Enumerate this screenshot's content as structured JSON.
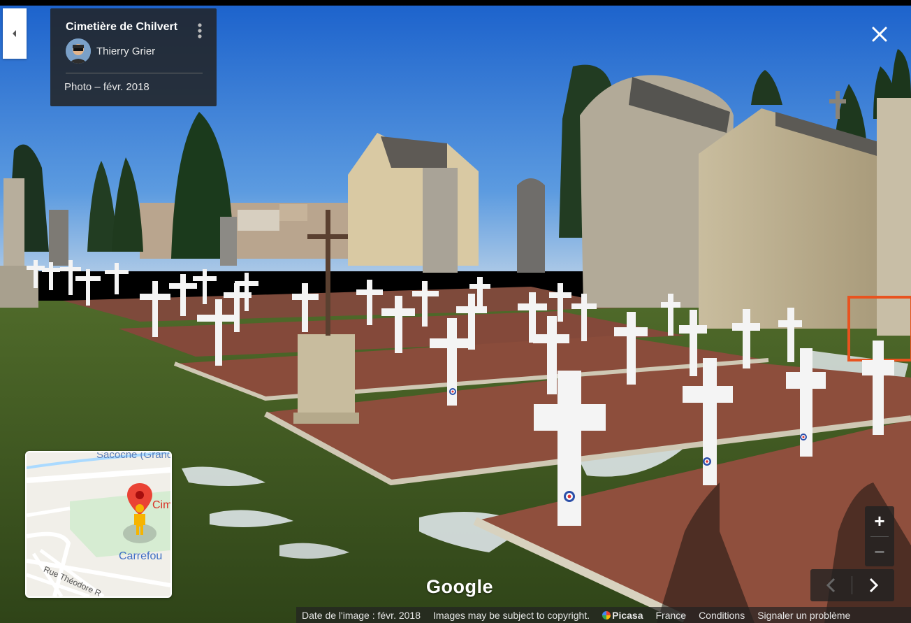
{
  "place": {
    "title": "Cimetière de Chilvert",
    "author": "Thierry Grier",
    "photo_date": "Photo – févr. 2018"
  },
  "minimap": {
    "label_top": "Sacoche (Grand",
    "label_place": "Cim",
    "label_store": "Carrefou",
    "label_street": "Rue Théodore R"
  },
  "branding": {
    "logo": "Google"
  },
  "zoom": {
    "in_label": "+",
    "out_label": "−"
  },
  "footer": {
    "image_date": "Date de l'image : févr. 2018",
    "copyright": "Images may be subject to copyright.",
    "picasa": "Picasa",
    "country": "France",
    "terms": "Conditions",
    "report": "Signaler un problème"
  },
  "icons": {
    "back": "chevron-left-icon",
    "more": "more-vert-icon",
    "close": "close-icon",
    "pin": "map-pin-icon",
    "pegman": "pegman-icon",
    "prev": "chevron-left-icon",
    "next": "chevron-right-icon"
  },
  "colors": {
    "panel_bg": "#222222",
    "sky": "#2f7ad8",
    "grass": "#3f5a22",
    "gravel": "#8a4a3a",
    "pin_red": "#ea4335",
    "pegman_yellow": "#f6b400"
  }
}
